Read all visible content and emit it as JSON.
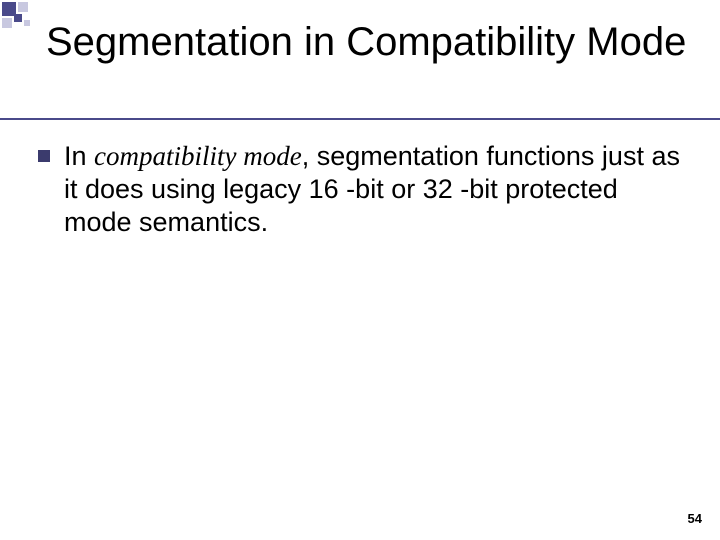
{
  "slide": {
    "title": "Segmentation in Compatibility Mode",
    "bullet": {
      "prefix": "In ",
      "italic": "compatibility mode",
      "suffix": ", segmentation functions just as it does using legacy 16 -bit or 32 -bit protected mode semantics."
    },
    "page_number": "54"
  }
}
